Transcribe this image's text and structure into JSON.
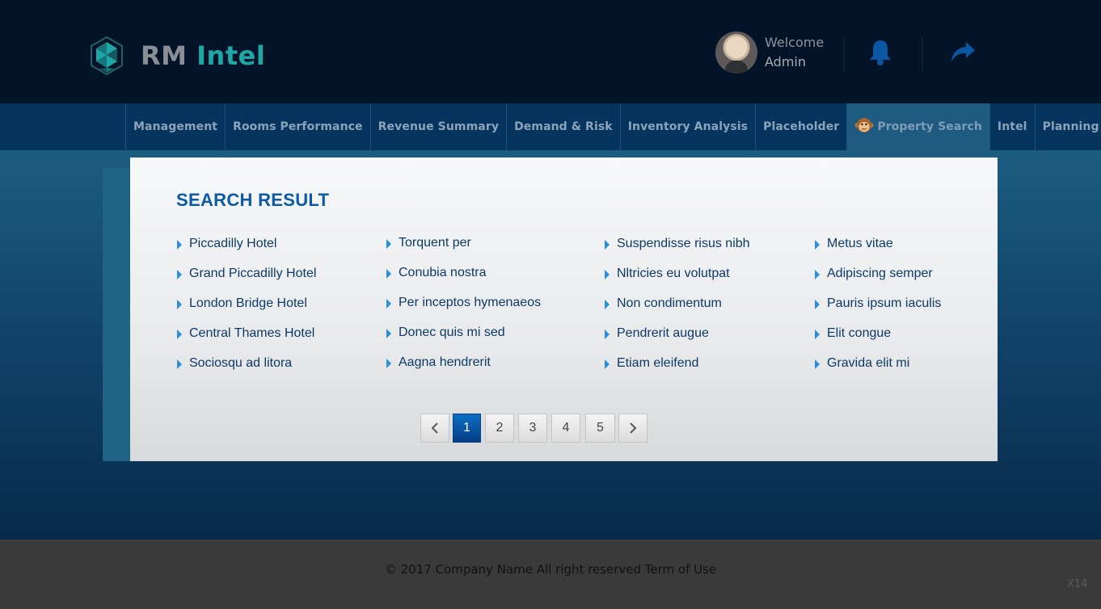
{
  "header": {
    "logo": {
      "rm": "RM",
      "intel": "Intel"
    },
    "welcome": "Welcome",
    "user": "Admin",
    "icons": [
      "logo-hexagon-icon",
      "avatar",
      "bell-icon",
      "share-arrow-icon"
    ]
  },
  "nav": {
    "items": [
      {
        "label": "Management"
      },
      {
        "label": "Rooms Performance"
      },
      {
        "label": "Revenue Summary"
      },
      {
        "label": "Demand & Risk"
      },
      {
        "label": "Inventory Analysis"
      },
      {
        "label": "Placeholder"
      },
      {
        "label": "Property Search",
        "active": true,
        "icon": "monkey-icon"
      },
      {
        "label": "Intel"
      },
      {
        "label": "Planning"
      }
    ]
  },
  "search": {
    "title": "SEARCH RESULT",
    "columns": [
      [
        "Piccadilly Hotel",
        "Grand Piccadilly Hotel",
        "London Bridge Hotel",
        "Central Thames Hotel",
        "Sociosqu ad litora"
      ],
      [
        "Torquent per",
        "Conubia nostra",
        "Per inceptos hymenaeos",
        "Donec quis mi sed",
        "Aagna hendrerit"
      ],
      [
        "Suspendisse risus nibh",
        "Nltricies eu volutpat",
        "Non condimentum",
        "Pendrerit augue",
        "Etiam eleifend"
      ],
      [
        "Metus vitae",
        "Adipiscing semper",
        "Pauris ipsum iaculis",
        "Elit congue",
        "Gravida elit mi"
      ]
    ]
  },
  "pagination": {
    "pages": [
      "1",
      "2",
      "3",
      "4",
      "5"
    ],
    "current": "1",
    "prev_icon": "chevron-left-icon",
    "next_icon": "chevron-right-icon"
  },
  "footer": {
    "text": "© 2017 Company Name  All right reserved  Term of Use",
    "code": "X14"
  },
  "colors": {
    "header_bg": "#041428",
    "nav_bg": "#05355f",
    "accent_title": "#0b5aa5",
    "active_page": "#0a5fae",
    "logo_teal": "#1fa7a5"
  }
}
